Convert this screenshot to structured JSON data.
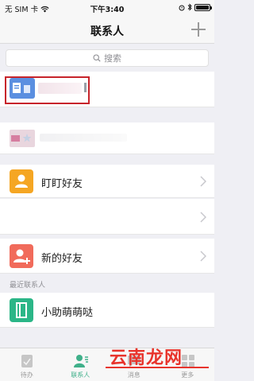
{
  "status_bar": {
    "carrier": "无 SIM 卡",
    "time": "下午3:40"
  },
  "nav": {
    "title": "联系人"
  },
  "search": {
    "placeholder": "搜索"
  },
  "rows": {
    "friends": {
      "label": "盯盯好友"
    },
    "new_friends": {
      "label": "新的好友"
    },
    "recent_section": {
      "label": "最近联系人"
    },
    "assistant": {
      "label": "小助萌萌哒"
    }
  },
  "tabs": [
    {
      "label": "待办"
    },
    {
      "label": "联系人"
    },
    {
      "label": "消息"
    },
    {
      "label": "更多"
    }
  ],
  "watermark": {
    "text": "云南龙网"
  },
  "colors": {
    "accent_green": "#3fb08a",
    "orange_icon": "#f5a623",
    "red_icon": "#f16b5b",
    "teal_icon": "#2bb687",
    "highlight_red": "#c7242b"
  }
}
